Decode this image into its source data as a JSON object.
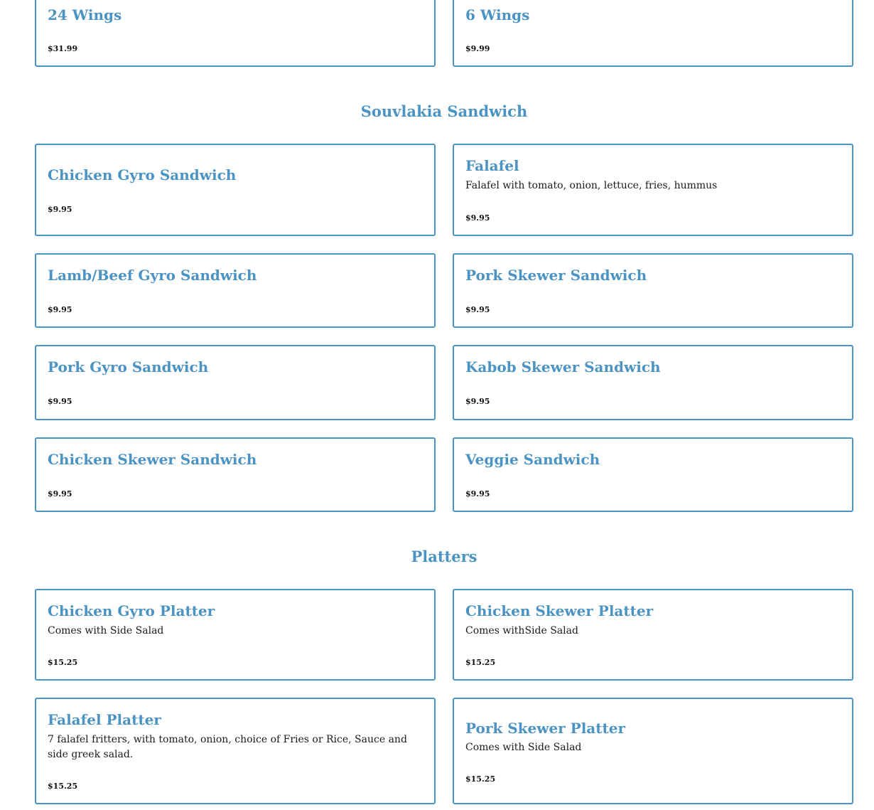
{
  "wings": {
    "items": [
      {
        "name": "24 Wings",
        "price": "$31.99"
      },
      {
        "name": "6 Wings",
        "price": "$9.99"
      }
    ]
  },
  "souvlakia": {
    "title": "Souvlakia Sandwich",
    "items": [
      {
        "name": "Chicken Gyro Sandwich",
        "price": "$9.95"
      },
      {
        "name": "Falafel",
        "description": "Falafel with tomato, onion, lettuce, fries, hummus",
        "price": "$9.95"
      },
      {
        "name": "Lamb/Beef Gyro Sandwich",
        "price": "$9.95"
      },
      {
        "name": "Pork Skewer Sandwich",
        "price": "$9.95"
      },
      {
        "name": "Pork Gyro Sandwich",
        "price": "$9.95"
      },
      {
        "name": "Kabob Skewer Sandwich",
        "price": "$9.95"
      },
      {
        "name": "Chicken Skewer Sandwich",
        "price": "$9.95"
      },
      {
        "name": "Veggie Sandwich",
        "price": "$9.95"
      }
    ]
  },
  "platters": {
    "title": "Platters",
    "items": [
      {
        "name": "Chicken Gyro Platter",
        "description": "Comes with Side Salad",
        "price": "$15.25"
      },
      {
        "name": "Chicken Skewer Platter",
        "description": "Comes withSide Salad",
        "price": "$15.25"
      },
      {
        "name": "Falafel Platter",
        "description": "7 falafel fritters, with tomato, onion, choice of Fries or Rice, Sauce and side greek salad.",
        "price": "$15.25"
      },
      {
        "name": "Pork Skewer Platter",
        "description": "Comes with Side Salad",
        "price": "$15.25"
      }
    ]
  }
}
